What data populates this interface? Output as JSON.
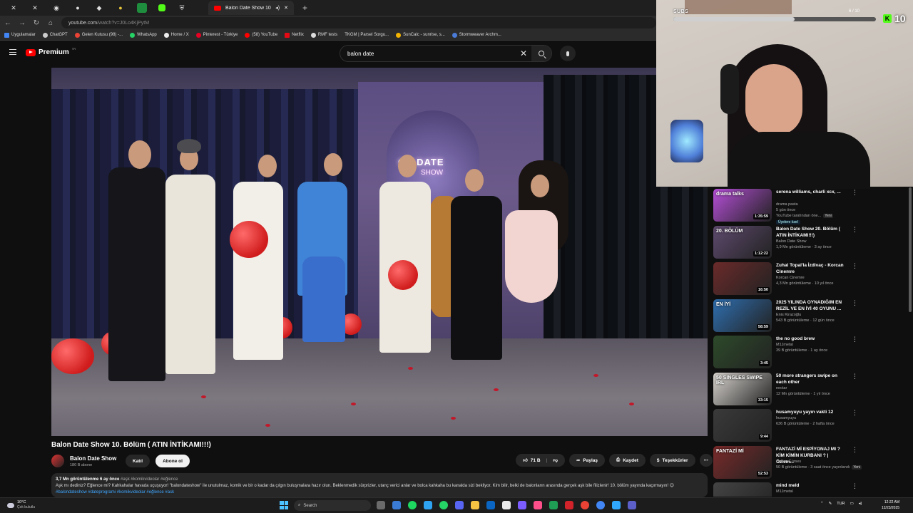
{
  "browser": {
    "tab_title": "Balon Date Show 10. Bölüm",
    "url_host": "youtube.com",
    "url_path": "/watch?v=J0Lo4KjPytM",
    "new_tab": "+",
    "bookmarks": [
      "Uygulamalar",
      "ChatGPT",
      "Gelen Kutusu (98) -...",
      "WhatsApp",
      "Home / X",
      "Pinterest - Türkiye",
      "(58) YouTube",
      "Netflix",
      "RMF tests",
      "TKGM | Parsel Sorgu...",
      "SunCalc - sunrise, s...",
      "Stormweaver Archm..."
    ]
  },
  "youtube": {
    "logo_text": "Premium",
    "logo_country": "TR",
    "search_value": "balon date"
  },
  "video": {
    "neon_line1": "ON DATE",
    "neon_line2": "SHOW",
    "title": "Balon Date Show 10. Bölüm ( ATIN İNTİKAMI!!!)",
    "channel": "Balon Date Show",
    "subscribers": "180 B abone",
    "join_label": "Katıl",
    "subscribe_label": "Abone ol",
    "likes": "71 B",
    "share_label": "Paylaş",
    "save_label": "Kaydet",
    "thanks_label": "Teşekkürler",
    "more_label": "⋯",
    "desc_stats": "3,7 Mn görüntülenme  6 ay önce",
    "desc_tags_top": "#aşk #komikvideolar #eğlence",
    "desc_text": "Aşk mı dediniz? Eğlence mi? Kahkahalar havada uçuşuyor! \"balondateshow\" ile unutulmaz, komik ve bir o kadar da çılgın buluşmalara hazır olun. Beklenmedik sürprizler, utanç verici anlar ve bolca kahkaha bu kanalda sizi bekliyor. Kim bilir, belki de balonların arasında gerçek aşk bile filizlenir! 10. bölüm yayında kaçırmayın! 😊",
    "desc_tags_bottom": "#balondateshow #dateprogrami #komikvideolar #eğlence #ask"
  },
  "overlay": {
    "subs_label": "SUBS",
    "subs_progress": "6 / 10",
    "subs_fraction": 0.6,
    "kick_count": "10"
  },
  "recommendations": [
    {
      "title": "serena williams, charli xcx, ...",
      "channel": "drama pasta",
      "meta": "5 gün önce",
      "extra": "YouTube tarafından öne...",
      "badge": "Yeni",
      "members": "Üyelere özel",
      "duration": "1:35:59",
      "thumb_text": "drama talks",
      "thumb_color": "#b64fd8"
    },
    {
      "title": "Balon Date Show 20. Bölüm ( ATIN İNTİKAMI!!!)",
      "channel": "Balon Date Show",
      "meta": "1,9 Mn görüntüleme · 3 ay önce",
      "duration": "1:12:22",
      "thumb_text": "20. BÖLÜM",
      "thumb_color": "#5e4a6e"
    },
    {
      "title": "Zuhal Topal'la İzdivaç - Korcan Cinemre",
      "channel": "Korcan Cinemre",
      "meta": "4,3 Mn görüntüleme · 10 yıl önce",
      "duration": "16:50",
      "thumb_text": "",
      "thumb_color": "#6b2a2a"
    },
    {
      "title": "2025 YILINDA OYNADIĞIM EN REZİL VE EN İYİ 40 OYUNU ...",
      "channel": "Enis Kirazoğlu",
      "meta": "543 B görüntüleme · 12 gün önce",
      "duration": "58:59",
      "thumb_text": "EN İYİ",
      "thumb_color": "#2f6fb0"
    },
    {
      "title": "the no good brew",
      "channel": "M1Jmetal",
      "meta": "39 B görüntüleme · 1 ay önce",
      "duration": "3:45",
      "thumb_text": "",
      "thumb_color": "#2d4a2a"
    },
    {
      "title": "50 more strangers swipe on each other",
      "channel": "nectar",
      "meta": "12 Mn görüntüleme · 1 yıl önce",
      "duration": "33:15",
      "thumb_text": "50 SINGLES SWIPE IRL",
      "thumb_color": "#d8d4cf"
    },
    {
      "title": "husamyuyu yayın vakti 12",
      "channel": "husamyuyu",
      "meta": "636 B görüntüleme · 2 hafta önce",
      "duration": "9:44",
      "thumb_text": "",
      "thumb_color": "#3a3a3a"
    },
    {
      "title": "FANTAZİ Mİ ESPİYONAJ MI ? KİM KİMİN KURBANI ? | Özlem...",
      "channel": "Özlem Gürses",
      "meta": "50 B görüntüleme · 3 saat önce yayınlandı",
      "badge": "Yeni",
      "duration": "52:53",
      "thumb_text": "FANTAZİ Mİ",
      "thumb_color": "#7a2a2a"
    },
    {
      "title": "mind meld",
      "channel": "M1Jmetal",
      "meta": "",
      "duration": "",
      "thumb_text": "",
      "thumb_color": "#444"
    }
  ],
  "taskbar": {
    "temp": "10°C",
    "condition": "Çok bulutlu",
    "search": "Search",
    "lang": "TUR",
    "time": "12:22 AM",
    "date": "12/23/2025"
  }
}
